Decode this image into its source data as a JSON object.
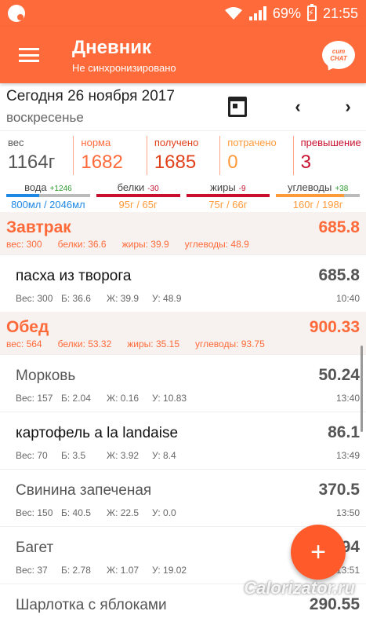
{
  "status": {
    "battery": "69%",
    "time": "21:55"
  },
  "appbar": {
    "title": "Дневник",
    "subtitle": "Не синхронизировано",
    "chat_line1": "сит",
    "chat_line2": "CHAT"
  },
  "date": {
    "main": "Сегодня 26 ноября 2017",
    "sub": "воскресенье",
    "prev": "‹",
    "next": "›"
  },
  "stats": [
    {
      "label": "вес",
      "value": "1164г",
      "label_color": "#555555",
      "value_color": "#555555"
    },
    {
      "label": "норма",
      "value": "1682",
      "label_color": "#ff6a3a",
      "value_color": "#ff6a3a"
    },
    {
      "label": "получено",
      "value": "1685",
      "label_color": "#e0401a",
      "value_color": "#e0401a"
    },
    {
      "label": "потрачено",
      "value": "0",
      "label_color": "#ff9a3a",
      "value_color": "#ff9a3a"
    },
    {
      "label": "превышение",
      "value": "3",
      "label_color": "#c8102e",
      "value_color": "#c8102e"
    }
  ],
  "bars": [
    {
      "label": "вода",
      "delta": "+1246",
      "delta_color": "#2e9a2e",
      "value": "800мл / 2046мл",
      "value_color": "#1e88e5",
      "fill_color": "#1e88e5",
      "fill": 0.39
    },
    {
      "label": "белки",
      "delta": "-30",
      "delta_color": "#c8102e",
      "value": "95г / 65г",
      "value_color": "#ff9a3a",
      "fill_color": "#c8102e",
      "fill": 1.0
    },
    {
      "label": "жиры",
      "delta": "-9",
      "delta_color": "#c8102e",
      "value": "75г / 66г",
      "value_color": "#ff9a3a",
      "fill_color": "#c8102e",
      "fill": 1.0
    },
    {
      "label": "углеводы",
      "delta": "+38",
      "delta_color": "#2e9a2e",
      "value": "160г / 198г",
      "value_color": "#ff9a3a",
      "fill_color": "#ff9a3a",
      "fill": 0.81
    }
  ],
  "meals": [
    {
      "name": "Завтрак",
      "total": "685.8",
      "macros": [
        "вес: 300",
        "белки: 36.6",
        "жиры: 39.9",
        "углеводы: 48.9"
      ],
      "foods": [
        {
          "name": "пасха из творога",
          "value": "685.8",
          "grey": false,
          "macros": [
            "Вес: 300",
            "Б: 36.6",
            "Ж: 39.9",
            "У: 48.9"
          ],
          "time": "10:40"
        }
      ]
    },
    {
      "name": "Обед",
      "total": "900.33",
      "macros": [
        "вес: 564",
        "белки: 53.32",
        "жиры: 35.15",
        "углеводы: 93.75"
      ],
      "foods": [
        {
          "name": "Морковь",
          "value": "50.24",
          "grey": true,
          "macros": [
            "Вес: 157",
            "Б: 2.04",
            "Ж: 0.16",
            "У: 10.83"
          ],
          "time": "13:40"
        },
        {
          "name": "картофель a la landaise",
          "value": "86.1",
          "grey": false,
          "macros": [
            "Вес: 70",
            "Б: 3.5",
            "Ж: 3.92",
            "У: 8.4"
          ],
          "time": "13:49"
        },
        {
          "name": "Свинина запеченая",
          "value": "370.5",
          "grey": true,
          "macros": [
            "Вес: 150",
            "Б: 40.5",
            "Ж: 22.5",
            "У: 0.0"
          ],
          "time": "13:50"
        },
        {
          "name": "Багет",
          "value": "96.94",
          "grey": true,
          "macros": [
            "Вес: 37",
            "Б: 2.78",
            "Ж: 1.07",
            "У: 19.02"
          ],
          "time": "13:51"
        },
        {
          "name": "Шарлотка с яблоками",
          "value": "290.55",
          "grey": true,
          "macros": [],
          "time": ""
        }
      ]
    }
  ],
  "fab": {
    "label": "+"
  },
  "watermark": "Calorizator.ru"
}
